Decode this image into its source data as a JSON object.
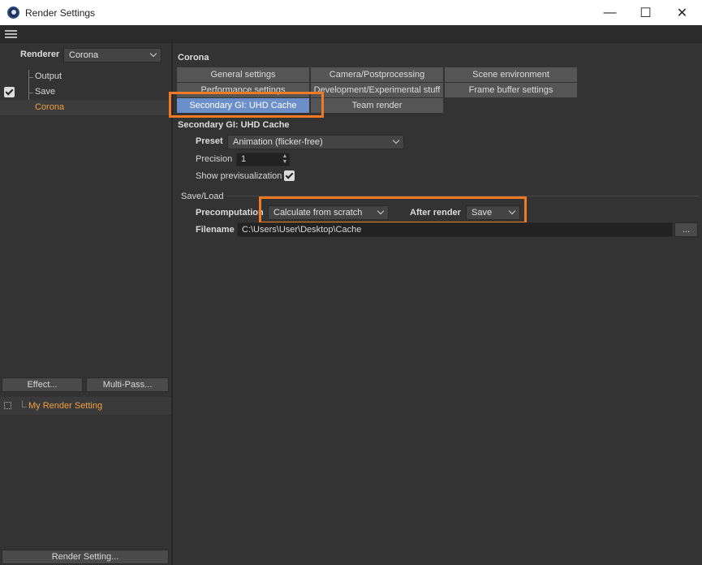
{
  "window": {
    "title": "Render Settings",
    "minimize_glyph": "—",
    "maximize_glyph": "☐",
    "close_glyph": "✕",
    "icon": "cinema4d-app-icon"
  },
  "left": {
    "renderer_label": "Renderer",
    "renderer_value": "Corona",
    "tree": [
      {
        "label": "Output",
        "checked": false,
        "active": false
      },
      {
        "label": "Save",
        "checked": true,
        "active": false
      },
      {
        "label": "Corona",
        "checked": false,
        "active": true
      }
    ],
    "effect_button": "Effect...",
    "multipass_button": "Multi-Pass...",
    "render_setting_item": "My Render Setting",
    "render_setting_button": "Render Setting..."
  },
  "right": {
    "section_title": "Corona",
    "tabs_row1": [
      "General settings",
      "Camera/Postprocessing",
      "Scene environment"
    ],
    "tabs_row2": [
      "Performance settings",
      "Development/Experimental stuff",
      "Frame buffer settings"
    ],
    "tabs_row3": [
      "Secondary GI: UHD Cache",
      "Team render"
    ],
    "active_tab": "Secondary GI: UHD Cache",
    "uhd_title": "Secondary GI: UHD Cache",
    "preset_label": "Preset",
    "preset_value": "Animation (flicker-free)",
    "precision_label": "Precision",
    "precision_value": "1",
    "show_prev_label": "Show previsualization",
    "show_prev_checked": true,
    "saveload_label": "Save/Load",
    "precomp_label": "Precomputation",
    "precomp_value": "Calculate from scratch",
    "after_render_label": "After render",
    "after_render_value": "Save",
    "filename_label": "Filename",
    "filename_value": "C:\\Users\\User\\Desktop\\Cache",
    "browse_button": "..."
  },
  "colors": {
    "highlight": "#f07a24",
    "active_tab": "#6b8fc9",
    "active_tree_text": "#f0a040"
  }
}
